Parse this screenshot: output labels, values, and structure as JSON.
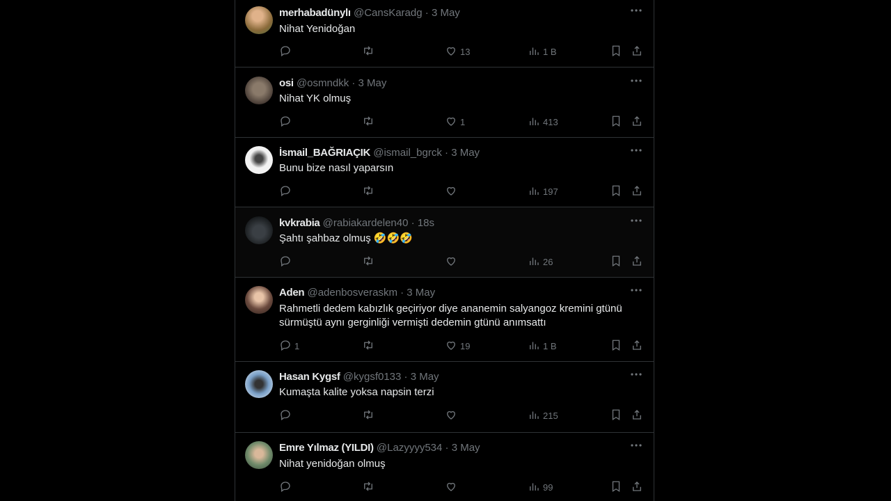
{
  "tweets": [
    {
      "name": "merhabadünylı",
      "handle": "@CansKaradg",
      "time": "3 May",
      "text": "Nihat Yenidoğan",
      "replies": "",
      "likes": "13",
      "views": "1 B",
      "avatar_bg": "#8a6a3a"
    },
    {
      "name": "osi",
      "handle": "@osmndkk",
      "time": "3 May",
      "text": "Nihat YK olmuş",
      "replies": "",
      "likes": "1",
      "views": "413",
      "avatar_bg": "#5b4a3a"
    },
    {
      "name": "İsmail_BAĞRIAÇIK",
      "handle": "@ismail_bgrck",
      "time": "3 May",
      "text": "Bunu bize nasıl yaparsın",
      "replies": "",
      "likes": "",
      "views": "197",
      "avatar_bg": "#f2f2f2"
    },
    {
      "name": "kvkrabia",
      "handle": "@rabiakardelen40",
      "time": "18s",
      "text": "Şahtı şahbaz olmuş 🤣🤣🤣",
      "replies": "",
      "likes": "",
      "views": "26",
      "avatar_bg": "#1f2326"
    },
    {
      "name": "Aden",
      "handle": "@adenbosveraskm",
      "time": "3 May",
      "text": "Rahmetli dedem kabızlık geçiriyor diye ananemin salyangoz kremini gtünü sürmüştü aynı gerginliği vermişti dedemin gtünü anımsattı",
      "replies": "1",
      "likes": "19",
      "views": "1 B",
      "avatar_bg": "#6b4a3e"
    },
    {
      "name": "Hasan Kygsf",
      "handle": "@kygsf0133",
      "time": "3 May",
      "text": "Kumaşta kalite yoksa napsin terzi",
      "replies": "",
      "likes": "",
      "views": "215",
      "avatar_bg": "#7aa0c8"
    },
    {
      "name": "Emre Yılmaz (YILDI)",
      "handle": "@Lazyyyy534",
      "time": "3 May",
      "text": "Nihat yenidoğan olmuş",
      "replies": "",
      "likes": "",
      "views": "99",
      "avatar_bg": "#6f8a6a"
    }
  ],
  "separator": "·",
  "icons": {
    "more": "more-icon",
    "reply": "reply-icon",
    "retweet": "retweet-icon",
    "like": "like-icon",
    "views": "views-icon",
    "bookmark": "bookmark-icon",
    "share": "share-icon"
  }
}
